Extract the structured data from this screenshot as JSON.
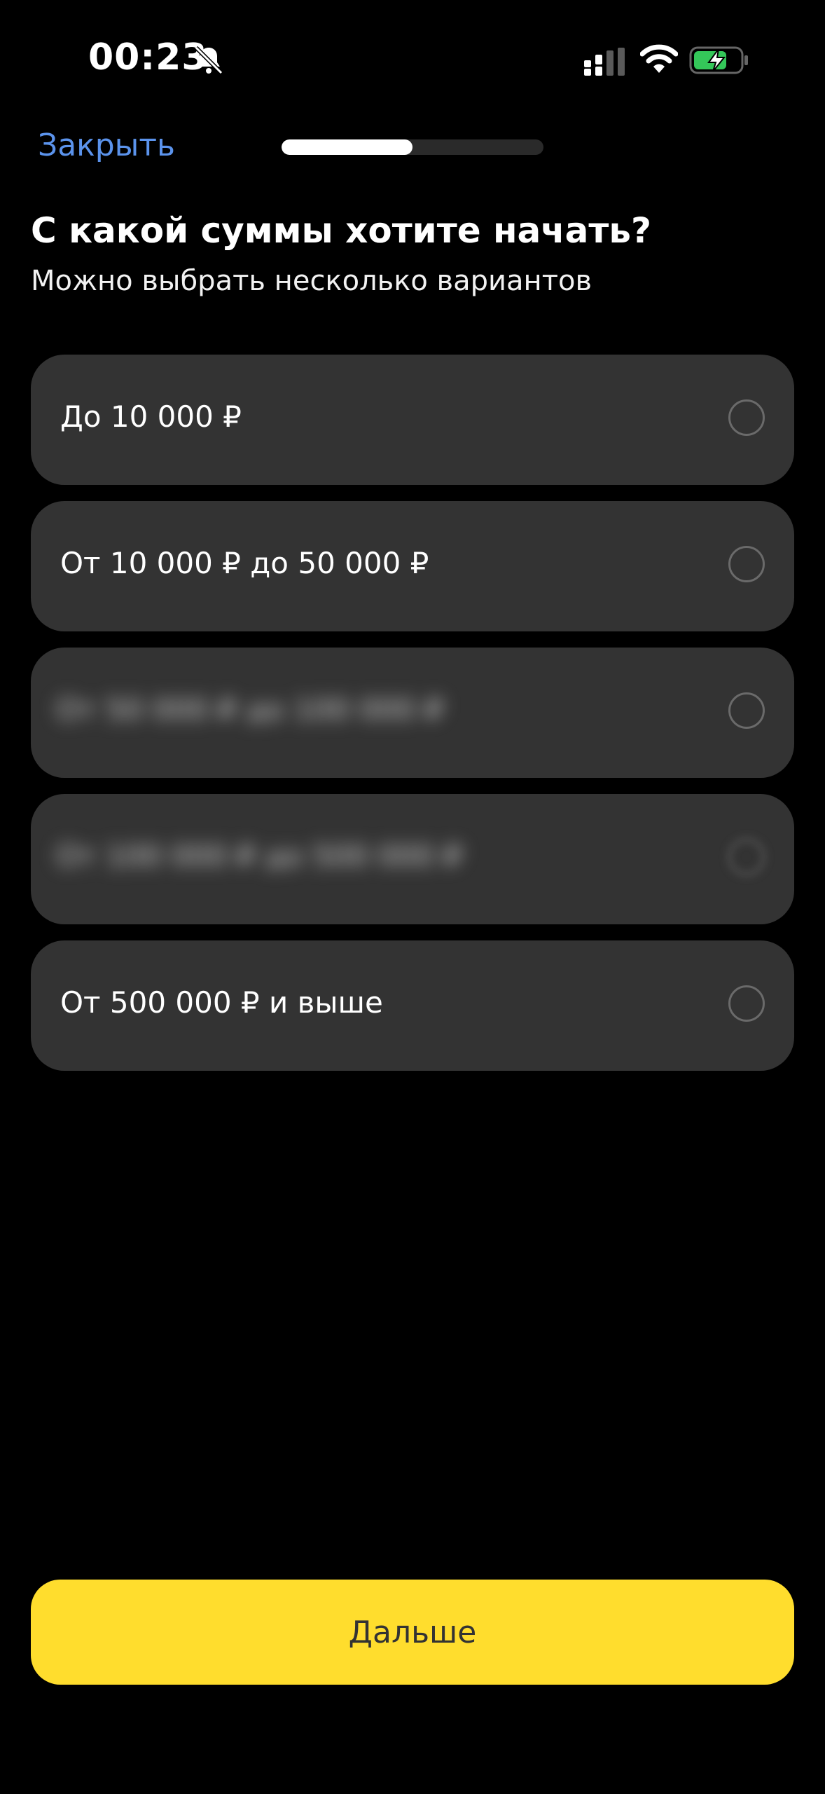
{
  "status_bar": {
    "time": "00:23",
    "icons": [
      "bell-slash-icon",
      "cellular-signal-icon",
      "wifi-icon",
      "battery-charging-icon"
    ],
    "battery_color": "#34c759"
  },
  "nav": {
    "close_label": "Закрыть",
    "progress_fraction": 0.5
  },
  "question": {
    "title": "С какой суммы хотите начать?",
    "subtitle": "Можно выбрать несколько вариантов"
  },
  "options": [
    {
      "label": "До 10 000 ₽",
      "selected": false,
      "obscured": false
    },
    {
      "label": "От 10 000 ₽ до 50 000 ₽",
      "selected": false,
      "obscured": false
    },
    {
      "label": "От 50 000 ₽ до 100 000 ₽",
      "selected": false,
      "obscured": true
    },
    {
      "label": "От 100 000 ₽ до 500 000 ₽",
      "selected": false,
      "obscured": true
    },
    {
      "label": "От 500 000 ₽ и выше",
      "selected": false,
      "obscured": false
    }
  ],
  "footer": {
    "next_label": "Дальше",
    "accent_color": "#ffdd2d"
  }
}
